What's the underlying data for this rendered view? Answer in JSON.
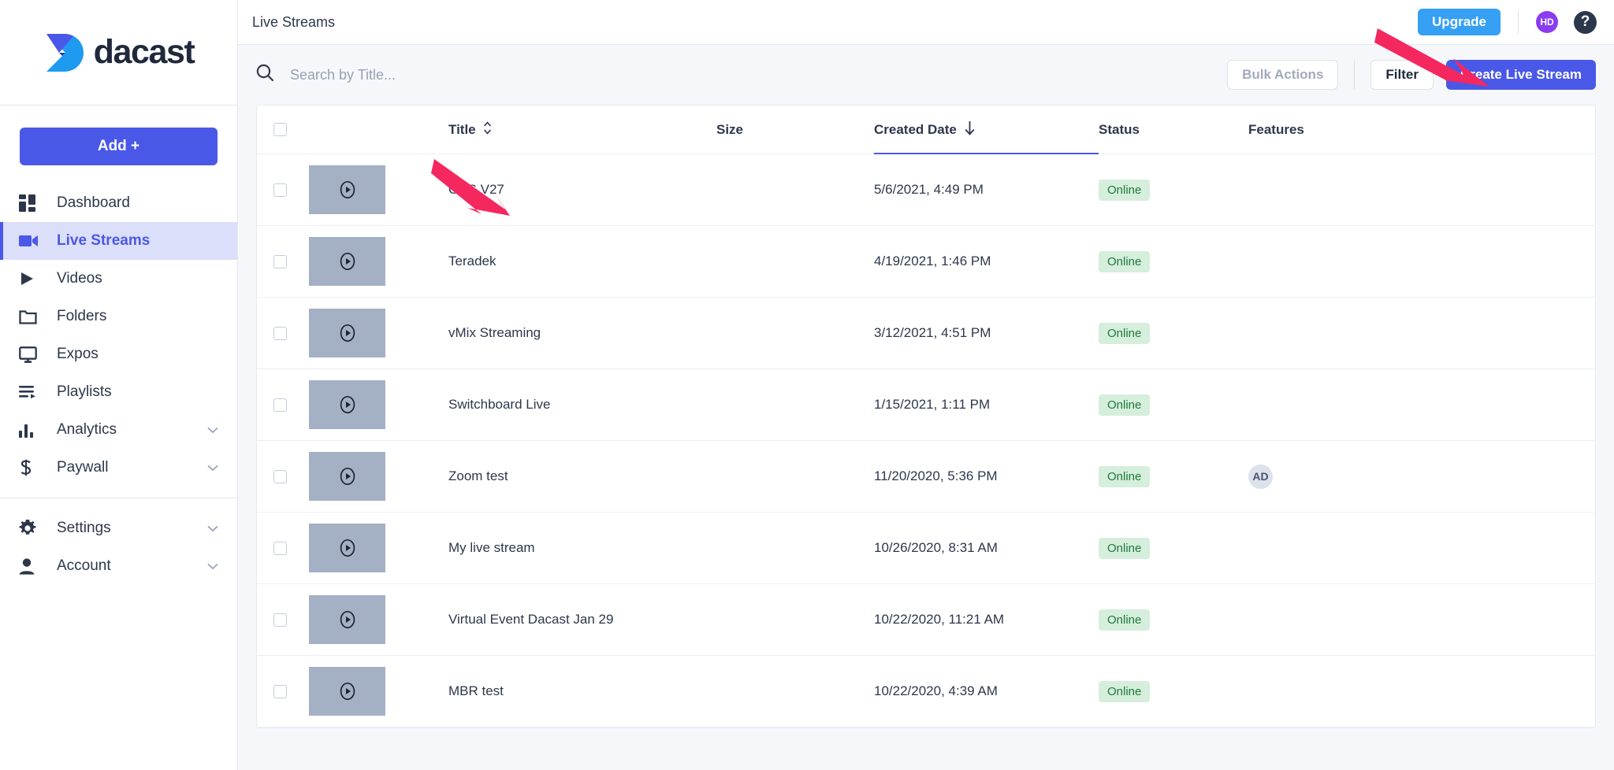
{
  "brand": {
    "name": "dacast",
    "primary": "#4a58e8",
    "logo_icon": "dacast-chevron-logo"
  },
  "sidebar": {
    "add_button": "Add +",
    "items": [
      {
        "label": "Dashboard",
        "icon": "dashboard-grid-icon",
        "active": false,
        "chevron": false
      },
      {
        "label": "Live Streams",
        "icon": "video-camera-icon",
        "active": true,
        "chevron": false
      },
      {
        "label": "Videos",
        "icon": "play-triangle-icon",
        "active": false,
        "chevron": false
      },
      {
        "label": "Folders",
        "icon": "folder-icon",
        "active": false,
        "chevron": false
      },
      {
        "label": "Expos",
        "icon": "monitor-icon",
        "active": false,
        "chevron": false
      },
      {
        "label": "Playlists",
        "icon": "playlist-icon",
        "active": false,
        "chevron": false
      },
      {
        "label": "Analytics",
        "icon": "bar-chart-icon",
        "active": false,
        "chevron": true
      },
      {
        "label": "Paywall",
        "icon": "dollar-icon",
        "active": false,
        "chevron": true
      }
    ],
    "bottom_items": [
      {
        "label": "Settings",
        "icon": "gear-icon",
        "active": false,
        "chevron": true
      },
      {
        "label": "Account",
        "icon": "person-icon",
        "active": false,
        "chevron": true
      }
    ]
  },
  "header": {
    "title": "Live Streams",
    "upgrade_label": "Upgrade",
    "upgrade_color": "#35a0f4",
    "avatar_initials": "HD",
    "avatar_color": "#8b3cf0",
    "help_glyph": "?"
  },
  "toolbar": {
    "search_placeholder": "Search by Title...",
    "search_value": "",
    "bulk_actions_label": "Bulk Actions",
    "bulk_actions_disabled": true,
    "filter_label": "Filter",
    "create_label": "Create Live Stream"
  },
  "table": {
    "columns": [
      {
        "key": "title",
        "label": "Title",
        "sort": "both"
      },
      {
        "key": "size",
        "label": "Size",
        "sort": "none"
      },
      {
        "key": "created",
        "label": "Created Date",
        "sort": "desc"
      },
      {
        "key": "status",
        "label": "Status",
        "sort": "none"
      },
      {
        "key": "features",
        "label": "Features",
        "sort": "none"
      }
    ],
    "sorted_column": "Created Date",
    "sort_direction": "desc",
    "rows": [
      {
        "title": "OBS V27",
        "size": "",
        "created": "5/6/2021, 4:49 PM",
        "status": "Online",
        "features": ""
      },
      {
        "title": "Teradek",
        "size": "",
        "created": "4/19/2021, 1:46 PM",
        "status": "Online",
        "features": ""
      },
      {
        "title": "vMix Streaming",
        "size": "",
        "created": "3/12/2021, 4:51 PM",
        "status": "Online",
        "features": ""
      },
      {
        "title": "Switchboard Live",
        "size": "",
        "created": "1/15/2021, 1:11 PM",
        "status": "Online",
        "features": ""
      },
      {
        "title": "Zoom test",
        "size": "",
        "created": "11/20/2020, 5:36 PM",
        "status": "Online",
        "features": "AD"
      },
      {
        "title": "My live stream",
        "size": "",
        "created": "10/26/2020, 8:31 AM",
        "status": "Online",
        "features": ""
      },
      {
        "title": "Virtual Event Dacast Jan 29",
        "size": "",
        "created": "10/22/2020, 11:21 AM",
        "status": "Online",
        "features": ""
      },
      {
        "title": "MBR test",
        "size": "",
        "created": "10/22/2020, 4:39 AM",
        "status": "Online",
        "features": ""
      }
    ],
    "status_colors": {
      "online_bg": "#d6eedc",
      "online_text": "#1e7a3c"
    }
  },
  "annotations": {
    "arrow_color": "#f5275f",
    "arrows": [
      {
        "name": "arrow-to-create-live-stream",
        "points_to": "Create Live Stream"
      },
      {
        "name": "arrow-to-first-row-title",
        "points_to": "OBS V27"
      }
    ]
  }
}
